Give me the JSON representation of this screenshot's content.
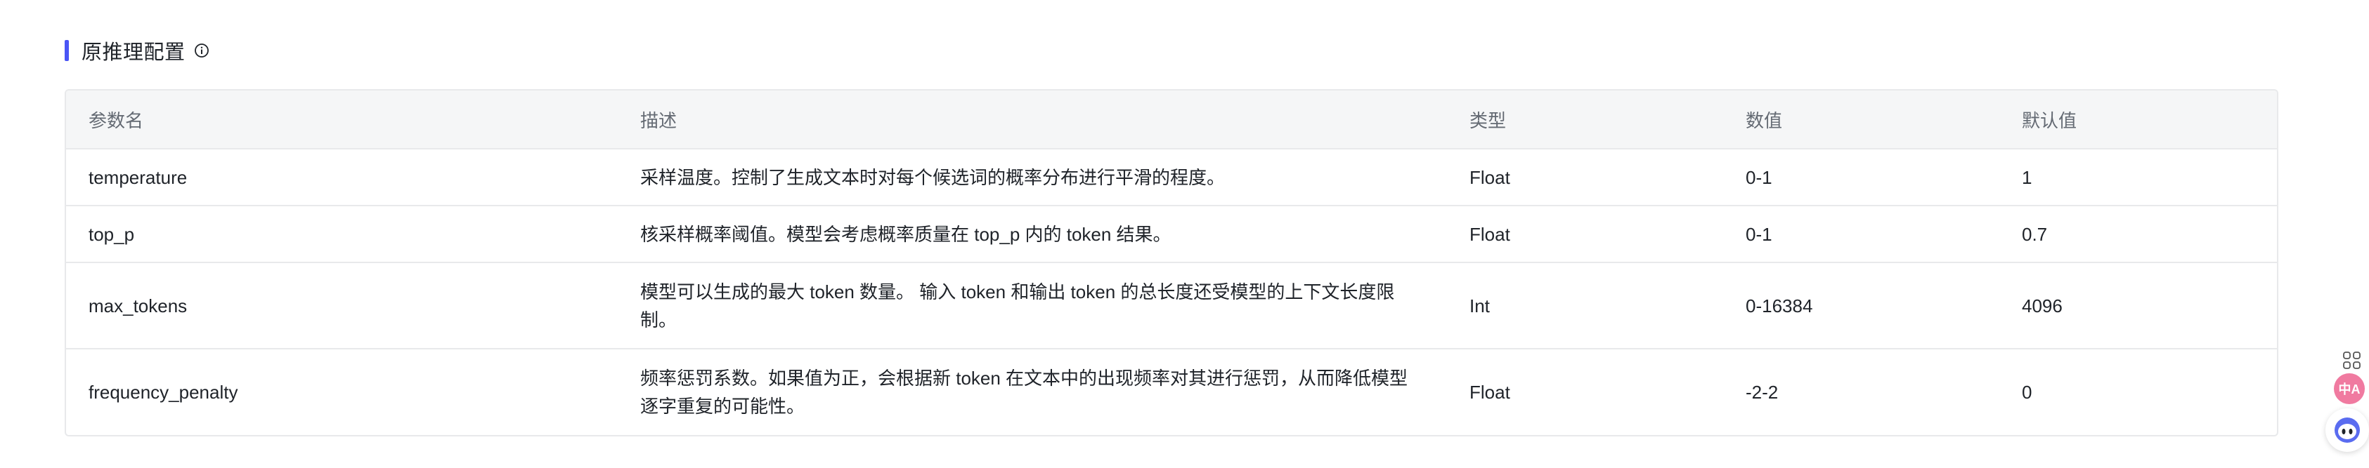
{
  "section": {
    "title": "原推理配置",
    "info_icon": "info-circle-icon",
    "accent_color": "#4a55f5"
  },
  "table": {
    "headers": {
      "name": "参数名",
      "description": "描述",
      "type": "类型",
      "value": "数值",
      "default": "默认值"
    },
    "rows": [
      {
        "name": "temperature",
        "description": "采样温度。控制了生成文本时对每个候选词的概率分布进行平滑的程度。",
        "type": "Float",
        "value": "0-1",
        "default": "1"
      },
      {
        "name": "top_p",
        "description": "核采样概率阈值。模型会考虑概率质量在 top_p 内的 token 结果。",
        "type": "Float",
        "value": "0-1",
        "default": "0.7"
      },
      {
        "name": "max_tokens",
        "description": "模型可以生成的最大 token 数量。 输入 token 和输出 token 的总长度还受模型的上下文长度限制。",
        "type": "Int",
        "value": "0-16384",
        "default": "4096"
      },
      {
        "name": "frequency_penalty",
        "description": "频率惩罚系数。如果值为正，会根据新 token 在文本中的出现频率对其进行惩罚，从而降低模型逐字重复的可能性。",
        "type": "Float",
        "value": "-2-2",
        "default": "0"
      }
    ]
  },
  "floating_tools": {
    "grid_icon": "grid-icon",
    "translate_icon": "translate-icon",
    "translate_label": "中A",
    "assistant_icon": "assistant-bot-icon"
  }
}
